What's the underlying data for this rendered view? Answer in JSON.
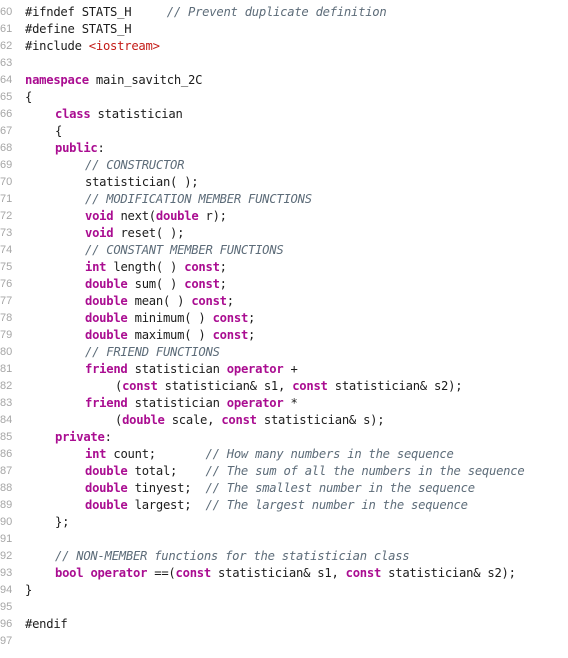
{
  "editor": {
    "language": "C++",
    "first_line_number": 60,
    "colors": {
      "keyword": "#aa0d91",
      "preprocessor": "#643820",
      "string": "#c41a16",
      "comment": "#5d6c79",
      "text": "#1c1c1c",
      "line_number": "#a6a6a6",
      "background": "#ffffff"
    },
    "lines": [
      {
        "n": "60",
        "indent": 0,
        "tokens": [
          {
            "t": "#ifndef STATS_H",
            "c": "tx"
          },
          {
            "t": "     ",
            "c": "tx"
          },
          {
            "t": "// Prevent duplicate definition",
            "c": "cm"
          }
        ]
      },
      {
        "n": "61",
        "indent": 0,
        "tokens": [
          {
            "t": "#define STATS_H",
            "c": "tx"
          }
        ]
      },
      {
        "n": "62",
        "indent": 0,
        "tokens": [
          {
            "t": "#include ",
            "c": "tx"
          },
          {
            "t": "<iostream>",
            "c": "str"
          }
        ]
      },
      {
        "n": "63",
        "indent": 0,
        "tokens": []
      },
      {
        "n": "64",
        "indent": 0,
        "tokens": [
          {
            "t": "namespace",
            "c": "kw"
          },
          {
            "t": " main_savitch_2C",
            "c": "tx"
          }
        ]
      },
      {
        "n": "65",
        "indent": 0,
        "tokens": [
          {
            "t": "{",
            "c": "tx"
          }
        ]
      },
      {
        "n": "66",
        "indent": 1,
        "tokens": [
          {
            "t": "class",
            "c": "kw"
          },
          {
            "t": " statistician",
            "c": "tx"
          }
        ]
      },
      {
        "n": "67",
        "indent": 1,
        "tokens": [
          {
            "t": "{",
            "c": "tx"
          }
        ]
      },
      {
        "n": "68",
        "indent": 1,
        "tokens": [
          {
            "t": "public",
            "c": "kw"
          },
          {
            "t": ":",
            "c": "tx"
          }
        ]
      },
      {
        "n": "69",
        "indent": 2,
        "tokens": [
          {
            "t": "// CONSTRUCTOR",
            "c": "cm"
          }
        ]
      },
      {
        "n": "70",
        "indent": 2,
        "tokens": [
          {
            "t": "statistician( );",
            "c": "tx"
          }
        ]
      },
      {
        "n": "71",
        "indent": 2,
        "tokens": [
          {
            "t": "// MODIFICATION MEMBER FUNCTIONS",
            "c": "cm"
          }
        ]
      },
      {
        "n": "72",
        "indent": 2,
        "tokens": [
          {
            "t": "void",
            "c": "kw"
          },
          {
            "t": " next(",
            "c": "tx"
          },
          {
            "t": "double",
            "c": "kw"
          },
          {
            "t": " r);",
            "c": "tx"
          }
        ]
      },
      {
        "n": "73",
        "indent": 2,
        "tokens": [
          {
            "t": "void",
            "c": "kw"
          },
          {
            "t": " reset( );",
            "c": "tx"
          }
        ]
      },
      {
        "n": "74",
        "indent": 2,
        "tokens": [
          {
            "t": "// CONSTANT MEMBER FUNCTIONS",
            "c": "cm"
          }
        ]
      },
      {
        "n": "75",
        "indent": 2,
        "tokens": [
          {
            "t": "int",
            "c": "kw"
          },
          {
            "t": " length( ) ",
            "c": "tx"
          },
          {
            "t": "const",
            "c": "kw"
          },
          {
            "t": ";",
            "c": "tx"
          }
        ]
      },
      {
        "n": "76",
        "indent": 2,
        "tokens": [
          {
            "t": "double",
            "c": "kw"
          },
          {
            "t": " sum( ) ",
            "c": "tx"
          },
          {
            "t": "const",
            "c": "kw"
          },
          {
            "t": ";",
            "c": "tx"
          }
        ]
      },
      {
        "n": "77",
        "indent": 2,
        "tokens": [
          {
            "t": "double",
            "c": "kw"
          },
          {
            "t": " mean( ) ",
            "c": "tx"
          },
          {
            "t": "const",
            "c": "kw"
          },
          {
            "t": ";",
            "c": "tx"
          }
        ]
      },
      {
        "n": "78",
        "indent": 2,
        "tokens": [
          {
            "t": "double",
            "c": "kw"
          },
          {
            "t": " minimum( ) ",
            "c": "tx"
          },
          {
            "t": "const",
            "c": "kw"
          },
          {
            "t": ";",
            "c": "tx"
          }
        ]
      },
      {
        "n": "79",
        "indent": 2,
        "tokens": [
          {
            "t": "double",
            "c": "kw"
          },
          {
            "t": " maximum( ) ",
            "c": "tx"
          },
          {
            "t": "const",
            "c": "kw"
          },
          {
            "t": ";",
            "c": "tx"
          }
        ]
      },
      {
        "n": "80",
        "indent": 2,
        "tokens": [
          {
            "t": "// FRIEND FUNCTIONS",
            "c": "cm"
          }
        ]
      },
      {
        "n": "81",
        "indent": 2,
        "tokens": [
          {
            "t": "friend",
            "c": "kw"
          },
          {
            "t": " statistician ",
            "c": "tx"
          },
          {
            "t": "operator",
            "c": "kw"
          },
          {
            "t": " +",
            "c": "tx"
          }
        ]
      },
      {
        "n": "82",
        "indent": 3,
        "tokens": [
          {
            "t": "(",
            "c": "tx"
          },
          {
            "t": "const",
            "c": "kw"
          },
          {
            "t": " statistician& s1, ",
            "c": "tx"
          },
          {
            "t": "const",
            "c": "kw"
          },
          {
            "t": " statistician& s2);",
            "c": "tx"
          }
        ]
      },
      {
        "n": "83",
        "indent": 2,
        "tokens": [
          {
            "t": "friend",
            "c": "kw"
          },
          {
            "t": " statistician ",
            "c": "tx"
          },
          {
            "t": "operator",
            "c": "kw"
          },
          {
            "t": " *",
            "c": "tx"
          }
        ]
      },
      {
        "n": "84",
        "indent": 3,
        "tokens": [
          {
            "t": "(",
            "c": "tx"
          },
          {
            "t": "double",
            "c": "kw"
          },
          {
            "t": " scale, ",
            "c": "tx"
          },
          {
            "t": "const",
            "c": "kw"
          },
          {
            "t": " statistician& s);",
            "c": "tx"
          }
        ]
      },
      {
        "n": "85",
        "indent": 1,
        "tokens": [
          {
            "t": "private",
            "c": "kw"
          },
          {
            "t": ":",
            "c": "tx"
          }
        ]
      },
      {
        "n": "86",
        "indent": 2,
        "tokens": [
          {
            "t": "int",
            "c": "kw"
          },
          {
            "t": " count;       ",
            "c": "tx"
          },
          {
            "t": "// How many numbers in the sequence",
            "c": "cm"
          }
        ]
      },
      {
        "n": "87",
        "indent": 2,
        "tokens": [
          {
            "t": "double",
            "c": "kw"
          },
          {
            "t": " total;    ",
            "c": "tx"
          },
          {
            "t": "// The sum of all the numbers in the sequence",
            "c": "cm"
          }
        ]
      },
      {
        "n": "88",
        "indent": 2,
        "tokens": [
          {
            "t": "double",
            "c": "kw"
          },
          {
            "t": " tinyest;  ",
            "c": "tx"
          },
          {
            "t": "// The smallest number in the sequence",
            "c": "cm"
          }
        ]
      },
      {
        "n": "89",
        "indent": 2,
        "tokens": [
          {
            "t": "double",
            "c": "kw"
          },
          {
            "t": " largest;  ",
            "c": "tx"
          },
          {
            "t": "// The largest number in the sequence",
            "c": "cm"
          }
        ]
      },
      {
        "n": "90",
        "indent": 1,
        "tokens": [
          {
            "t": "};",
            "c": "tx"
          }
        ]
      },
      {
        "n": "91",
        "indent": 0,
        "tokens": []
      },
      {
        "n": "92",
        "indent": 1,
        "tokens": [
          {
            "t": "// NON-MEMBER functions for the statistician class",
            "c": "cm"
          }
        ]
      },
      {
        "n": "93",
        "indent": 1,
        "tokens": [
          {
            "t": "bool",
            "c": "kw"
          },
          {
            "t": " ",
            "c": "tx"
          },
          {
            "t": "operator",
            "c": "kw"
          },
          {
            "t": " ==(",
            "c": "tx"
          },
          {
            "t": "const",
            "c": "kw"
          },
          {
            "t": " statistician& s1, ",
            "c": "tx"
          },
          {
            "t": "const",
            "c": "kw"
          },
          {
            "t": " statistician& s2);",
            "c": "tx"
          }
        ]
      },
      {
        "n": "94",
        "indent": 0,
        "tokens": [
          {
            "t": "}",
            "c": "tx"
          }
        ]
      },
      {
        "n": "95",
        "indent": 0,
        "tokens": []
      },
      {
        "n": "96",
        "indent": 0,
        "tokens": [
          {
            "t": "#endif",
            "c": "tx"
          }
        ]
      },
      {
        "n": "97",
        "indent": 0,
        "tokens": []
      }
    ]
  }
}
